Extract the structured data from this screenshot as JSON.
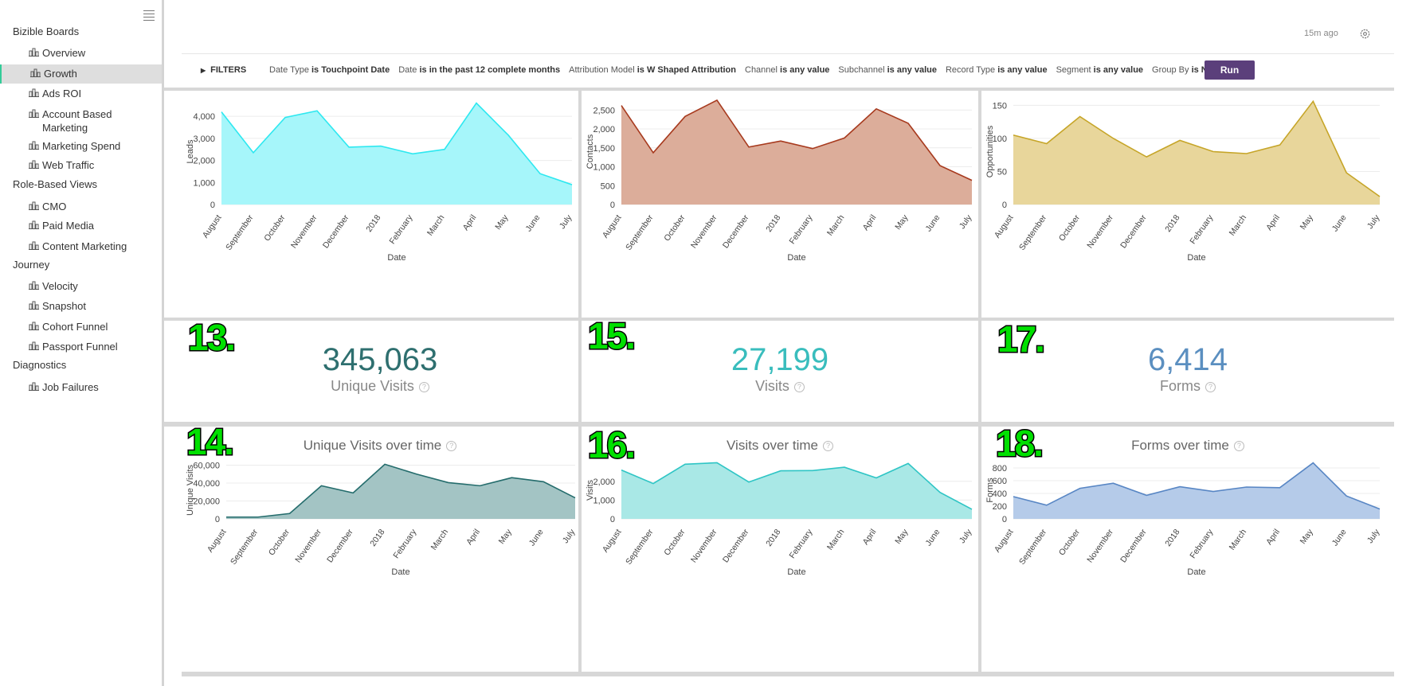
{
  "sidebar": {
    "groups": [
      {
        "label": "Bizible Boards",
        "items": [
          "Overview",
          "Growth",
          "Ads ROI",
          "Account Based Marketing",
          "Marketing Spend",
          "Web Traffic"
        ]
      },
      {
        "label": "Role-Based Views",
        "items": [
          "CMO",
          "Paid Media",
          "Content Marketing"
        ]
      },
      {
        "label": "Journey",
        "items": [
          "Velocity",
          "Snapshot",
          "Cohort Funnel",
          "Passport Funnel"
        ]
      },
      {
        "label": "Diagnostics",
        "items": [
          "Job Failures"
        ]
      }
    ],
    "active_item": "Growth"
  },
  "header": {
    "last_run": "15m ago"
  },
  "filters": {
    "toggle_label": "FILTERS",
    "items": [
      {
        "name": "Date Type",
        "value": "is Touchpoint Date"
      },
      {
        "name": "Date",
        "value": "is in the past 12 complete months"
      },
      {
        "name": "Attribution Model",
        "value": "is W Shaped Attribution"
      },
      {
        "name": "Channel",
        "value": "is any value"
      },
      {
        "name": "Subchannel",
        "value": "is any value"
      },
      {
        "name": "Record Type",
        "value": "is any value"
      },
      {
        "name": "Segment",
        "value": "is any value"
      },
      {
        "name": "Group By",
        "value": "is None"
      }
    ],
    "run_label": "Run"
  },
  "kpis": [
    {
      "value": "345,063",
      "label": "Unique Visits",
      "color": "#2e6f6f",
      "badge": "13."
    },
    {
      "value": "27,199",
      "label": "Visits",
      "color": "#39bdbd",
      "badge": "15."
    },
    {
      "value": "6,414",
      "label": "Forms",
      "color": "#5b8fc0",
      "badge": "17."
    }
  ],
  "badges_bottom": [
    "14.",
    "16.",
    "18."
  ],
  "chart_data": [
    {
      "type": "area",
      "title": "",
      "xlabel": "Date",
      "ylabel": "Leads",
      "categories": [
        "August",
        "September",
        "October",
        "November",
        "December",
        "2018",
        "February",
        "March",
        "April",
        "May",
        "June",
        "July"
      ],
      "values": [
        4200,
        2350,
        3950,
        4250,
        2600,
        2650,
        2300,
        2500,
        4600,
        3150,
        1400,
        900
      ],
      "ylim": [
        0,
        4800
      ],
      "yticks": [
        0,
        1000,
        2000,
        3000,
        4000
      ],
      "yticklabels": [
        "0",
        "1,000",
        "2,000",
        "3,000",
        "4,000"
      ],
      "line_color": "#2ee8f0",
      "fill_color": "#a6f6fa"
    },
    {
      "type": "area",
      "title": "",
      "xlabel": "Date",
      "ylabel": "Contacts",
      "categories": [
        "August",
        "September",
        "October",
        "November",
        "December",
        "2018",
        "February",
        "March",
        "April",
        "May",
        "June",
        "July"
      ],
      "values": [
        2620,
        1370,
        2330,
        2760,
        1520,
        1680,
        1480,
        1760,
        2530,
        2150,
        1030,
        640
      ],
      "ylim": [
        0,
        2800
      ],
      "yticks": [
        0,
        500,
        1000,
        1500,
        2000,
        2500
      ],
      "yticklabels": [
        "0",
        "500",
        "1,000",
        "1,500",
        "2,000",
        "2,500"
      ],
      "line_color": "#a73a1e",
      "fill_color": "#dcad9a"
    },
    {
      "type": "area",
      "title": "",
      "xlabel": "Date",
      "ylabel": "Opportunities",
      "categories": [
        "August",
        "September",
        "October",
        "November",
        "December",
        "2018",
        "February",
        "March",
        "April",
        "May",
        "June",
        "July"
      ],
      "values": [
        105,
        92,
        133,
        100,
        72,
        97,
        80,
        77,
        90,
        156,
        48,
        12
      ],
      "ylim": [
        0,
        160
      ],
      "yticks": [
        0,
        50,
        100,
        150
      ],
      "yticklabels": [
        "0",
        "50",
        "100",
        "150"
      ],
      "line_color": "#c6a528",
      "fill_color": "#e8d69b"
    },
    {
      "type": "area",
      "title": "Unique Visits over time",
      "xlabel": "Date",
      "ylabel": "Unique Visits",
      "categories": [
        "August",
        "September",
        "October",
        "November",
        "December",
        "2018",
        "February",
        "March",
        "April",
        "May",
        "June",
        "July"
      ],
      "values": [
        2000,
        2000,
        6000,
        37000,
        29000,
        61000,
        50000,
        40500,
        37000,
        46000,
        41500,
        23500
      ],
      "ylim": [
        0,
        64000
      ],
      "yticks": [
        0,
        20000,
        40000,
        60000
      ],
      "yticklabels": [
        "0",
        "20,000",
        "40,000",
        "60,000"
      ],
      "line_color": "#246c6c",
      "fill_color": "#a3c4c4"
    },
    {
      "type": "area",
      "title": "Visits over time",
      "xlabel": "Date",
      "ylabel": "Visits",
      "categories": [
        "August",
        "September",
        "October",
        "November",
        "December",
        "2018",
        "February",
        "March",
        "April",
        "May",
        "June",
        "July"
      ],
      "values": [
        2600,
        1880,
        2910,
        2990,
        1960,
        2560,
        2570,
        2750,
        2180,
        2950,
        1410,
        510
      ],
      "ylim": [
        0,
        3050
      ],
      "yticks": [
        0,
        1000,
        2000
      ],
      "yticklabels": [
        "0",
        "1,000",
        "2,000"
      ],
      "line_color": "#2fc5c5",
      "fill_color": "#a9e8e6"
    },
    {
      "type": "area",
      "title": "Forms over time",
      "xlabel": "Date",
      "ylabel": "Forms",
      "categories": [
        "August",
        "September",
        "October",
        "November",
        "December",
        "2018",
        "February",
        "March",
        "April",
        "May",
        "June",
        "July"
      ],
      "values": [
        350,
        215,
        480,
        560,
        370,
        505,
        430,
        500,
        490,
        880,
        360,
        155
      ],
      "ylim": [
        0,
        900
      ],
      "yticks": [
        0,
        200,
        400,
        600,
        800
      ],
      "yticklabels": [
        "0",
        "200",
        "400",
        "600",
        "800"
      ],
      "line_color": "#5886c4",
      "fill_color": "#b5cbe9"
    }
  ]
}
